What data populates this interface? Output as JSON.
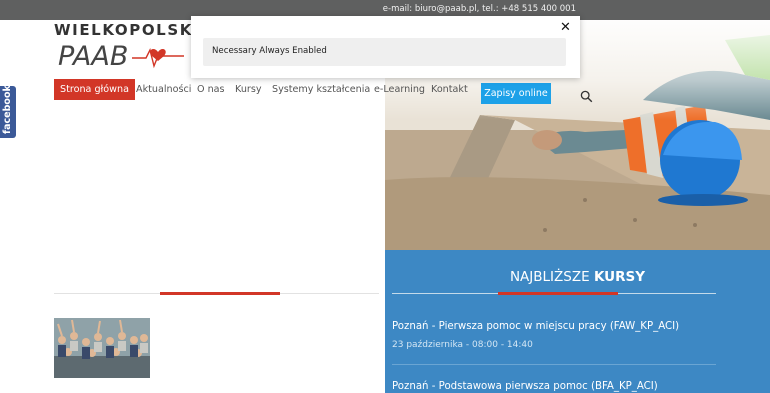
{
  "topbar": {
    "contact": "e-mail: biuro@paab.pl, tel.: +48 515 400 001"
  },
  "brand": {
    "text": "WIELKOPOLSKI I",
    "logo_text": "PAAB"
  },
  "nav": {
    "items": [
      {
        "label": "Strona główna",
        "active": true
      },
      {
        "label": "Aktualności"
      },
      {
        "label": "O nas"
      },
      {
        "label": "Kursy"
      },
      {
        "label": "Systemy kształcenia"
      },
      {
        "label": "e-Learning"
      },
      {
        "label": "Kontakt"
      }
    ],
    "cta": "Zapisy online",
    "search_icon": "search-icon"
  },
  "social": {
    "facebook": "facebook"
  },
  "cookie": {
    "row_label": "Necessary Always Enabled",
    "close": "✕"
  },
  "courses": {
    "title_light": "NAJBLIŻSZE",
    "title_bold": "KURSY",
    "items": [
      {
        "name": "Poznań - Pierwsza pomoc w miejscu pracy (FAW_KP_ACI)",
        "date": "23 października - 08:00 - 14:40"
      },
      {
        "name": "Poznań - Podstawowa pierwsza pomoc (BFA_KP_ACI)"
      }
    ]
  },
  "colors": {
    "accent_red": "#d23627",
    "cta_blue": "#1da1e8",
    "courses_blue": "#3d88c4",
    "facebook_blue": "#3b5998",
    "topbar_grey": "#5f6060"
  }
}
